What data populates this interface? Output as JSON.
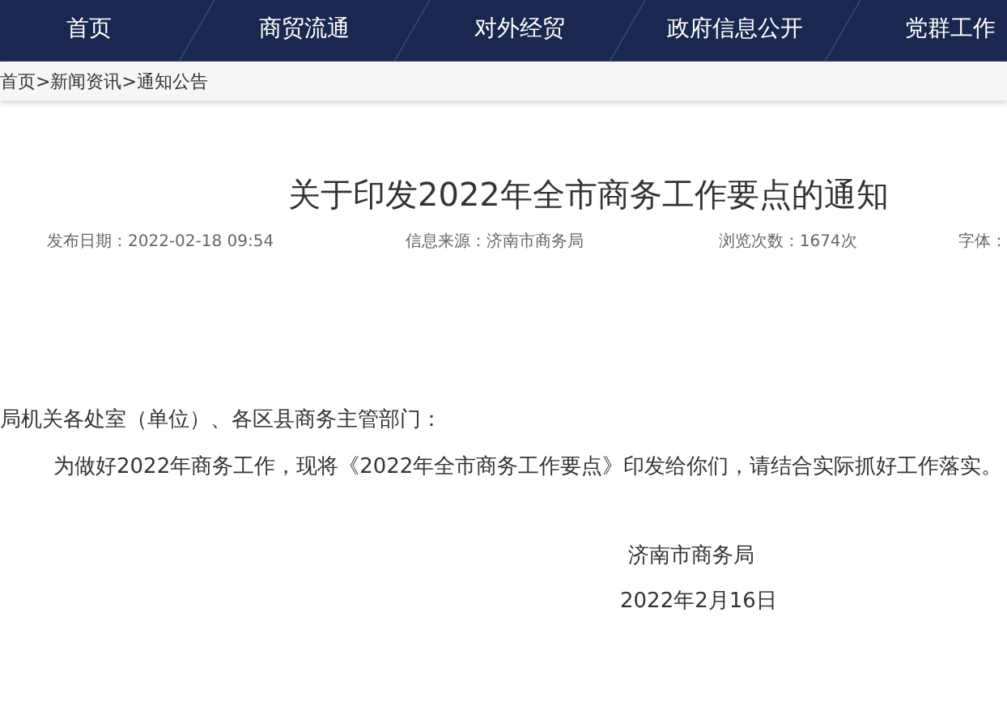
{
  "nav": {
    "items": [
      "首页",
      "商贸流通",
      "对外经贸",
      "政府信息公开",
      "党群工作"
    ]
  },
  "breadcrumb": "首页>新闻资讯>通知公告",
  "article": {
    "title": "关于印发2022年全市商务工作要点的通知",
    "meta": [
      "发布日期：2022-02-18 09:54",
      "信息来源：济南市商务局",
      "浏览次数：1674次",
      "字体："
    ],
    "salutation": "局机关各处室（单位）、各区县商务主管部门：",
    "body": "为做好2022年商务工作，现将《2022年全市商务工作要点》印发给你们，请结合实际抓好工作落实。",
    "signature": "济南市商务局",
    "date": "2022年2月16日"
  }
}
